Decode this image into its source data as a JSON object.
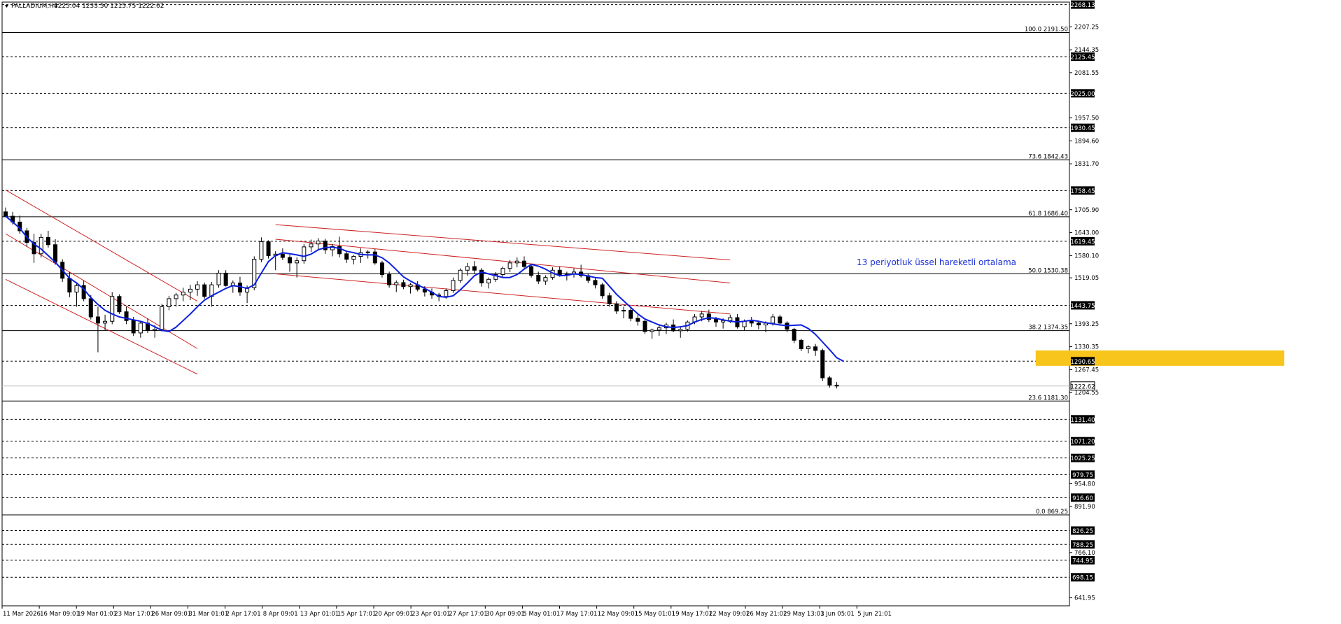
{
  "header": {
    "symbol": "PALLADIUM,H4",
    "ohlc": "1225.04 1233.50 1215.75 1222.62"
  },
  "annotation": {
    "ema_label": "13 periyotluk üssel hareketli ortalama"
  },
  "colors": {
    "background": "#ffffff",
    "candle": "#000000",
    "ema": "#0a1fe0",
    "channel": "#cc2222",
    "zone": "#f7c51b",
    "annotation": "#1a2fd6"
  },
  "chart_data": {
    "type": "candlestick",
    "ylim": [
      620,
      2275
    ],
    "y_tick_labels": [
      "2207.25",
      "2144.35",
      "2081.55",
      "1957.50",
      "1894.60",
      "1831.70",
      "1705.90",
      "1643.00",
      "1580.10",
      "1519.05",
      "1393.25",
      "1330.35",
      "1267.45",
      "1204.55",
      "891.90",
      "954.80",
      "766.10",
      "641.95"
    ],
    "y_ticks": [
      2207.25,
      2144.35,
      2081.55,
      1957.5,
      1894.6,
      1831.7,
      1705.9,
      1643.0,
      1580.1,
      1519.05,
      1393.25,
      1330.35,
      1267.45,
      1204.55,
      891.9,
      954.8,
      766.1,
      641.95
    ],
    "x_tick_labels": [
      "11 Mar 2026",
      "16 Mar 09:01",
      "19 Mar 01:01",
      "23 Mar 17:01",
      "26 Mar 09:01",
      "31 Mar 01:01",
      "2 Apr 17:01",
      "8 Apr 09:01",
      "13 Apr 01:01",
      "15 Apr 17:01",
      "20 Apr 09:01",
      "23 Apr 01:01",
      "27 Apr 17:01",
      "30 Apr 09:01",
      "5 May 01:01",
      "7 May 17:01",
      "12 May 09:01",
      "15 May 01:01",
      "19 May 17:01",
      "22 May 09:01",
      "26 May 21:01",
      "29 May 13:01",
      "3 Jun 05:01",
      "5 Jun 21:01"
    ],
    "horizontal_levels": [
      {
        "value": 2268.13,
        "label": "2268.13",
        "style": "dashed",
        "boxed": true
      },
      {
        "value": 2125.45,
        "label": "2125.45",
        "style": "dashed",
        "boxed": true
      },
      {
        "value": 2025.0,
        "label": "2025.00",
        "style": "dashed",
        "boxed": true
      },
      {
        "value": 1930.45,
        "label": "1930.45",
        "style": "dashed",
        "boxed": true
      },
      {
        "value": 1758.45,
        "label": "1758.45",
        "style": "dashed",
        "boxed": true
      },
      {
        "value": 1619.45,
        "label": "1619.45",
        "style": "dashed",
        "boxed": true
      },
      {
        "value": 1443.75,
        "label": "1443.75",
        "style": "dashed",
        "boxed": true
      },
      {
        "value": 1290.65,
        "label": "1290.65",
        "style": "dashed",
        "boxed": true
      },
      {
        "value": 1222.62,
        "label": "1222.62",
        "style": "current",
        "boxed": true
      },
      {
        "value": 1131.4,
        "label": "1131.40",
        "style": "dashed",
        "boxed": true
      },
      {
        "value": 1071.2,
        "label": "1071.20",
        "style": "dashed",
        "boxed": true
      },
      {
        "value": 1025.25,
        "label": "1025.25",
        "style": "dashed",
        "boxed": true
      },
      {
        "value": 979.75,
        "label": "979.75",
        "style": "dashed",
        "boxed": true
      },
      {
        "value": 916.6,
        "label": "916.60",
        "style": "dashed",
        "boxed": true
      },
      {
        "value": 826.25,
        "label": "826.25",
        "style": "dashed",
        "boxed": true
      },
      {
        "value": 788.25,
        "label": "788.25",
        "style": "dashed",
        "boxed": true
      },
      {
        "value": 744.95,
        "label": "744.95",
        "style": "dashed",
        "boxed": true
      },
      {
        "value": 698.15,
        "label": "698.15",
        "style": "dashed",
        "boxed": true
      }
    ],
    "fibonacci": [
      {
        "value": 2191.5,
        "label": "100.0 2191.50"
      },
      {
        "value": 1842.43,
        "label": "73.6 1842.43"
      },
      {
        "value": 1686.4,
        "label": "61.8 1686.40"
      },
      {
        "value": 1530.38,
        "label": "50.0 1530.38"
      },
      {
        "value": 1374.35,
        "label": "38.2 1374.35"
      },
      {
        "value": 1181.3,
        "label": "23.6 1181.30"
      },
      {
        "value": 869.25,
        "label": "0.0 869.25"
      }
    ],
    "ema_13": [
      1688,
      1672,
      1655,
      1630,
      1612,
      1598,
      1580,
      1562,
      1540,
      1518,
      1505,
      1488,
      1465,
      1446,
      1430,
      1420,
      1412,
      1408,
      1404,
      1400,
      1394,
      1385,
      1375,
      1372,
      1384,
      1402,
      1420,
      1440,
      1458,
      1470,
      1480,
      1490,
      1498,
      1495,
      1490,
      1500,
      1532,
      1564,
      1580,
      1588,
      1585,
      1582,
      1578,
      1584,
      1596,
      1602,
      1603,
      1600,
      1592,
      1588,
      1583,
      1582,
      1582,
      1574,
      1560,
      1541,
      1522,
      1510,
      1500,
      1490,
      1480,
      1468,
      1466,
      1470,
      1486,
      1505,
      1525,
      1535,
      1530,
      1525,
      1520,
      1520,
      1528,
      1543,
      1556,
      1551,
      1543,
      1532,
      1525,
      1526,
      1530,
      1528,
      1524,
      1520,
      1518,
      1496,
      1474,
      1456,
      1438,
      1420,
      1406,
      1398,
      1390,
      1385,
      1383,
      1385,
      1388,
      1398,
      1405,
      1410,
      1408,
      1404,
      1400,
      1398,
      1400,
      1403,
      1400,
      1396,
      1393,
      1390,
      1388,
      1389,
      1390,
      1380,
      1364,
      1343,
      1322,
      1300,
      1290
    ],
    "candles": [
      [
        1700,
        1712,
        1688,
        1688
      ],
      [
        1688,
        1700,
        1665,
        1672
      ],
      [
        1672,
        1690,
        1640,
        1648
      ],
      [
        1648,
        1656,
        1604,
        1616
      ],
      [
        1616,
        1640,
        1560,
        1585
      ],
      [
        1585,
        1640,
        1575,
        1630
      ],
      [
        1630,
        1648,
        1602,
        1610
      ],
      [
        1610,
        1625,
        1555,
        1562
      ],
      [
        1562,
        1570,
        1508,
        1518
      ],
      [
        1518,
        1535,
        1466,
        1480
      ],
      [
        1480,
        1505,
        1440,
        1498
      ],
      [
        1498,
        1512,
        1455,
        1462
      ],
      [
        1462,
        1472,
        1405,
        1412
      ],
      [
        1412,
        1440,
        1315,
        1395
      ],
      [
        1395,
        1418,
        1375,
        1400
      ],
      [
        1400,
        1480,
        1392,
        1468
      ],
      [
        1468,
        1474,
        1420,
        1426
      ],
      [
        1426,
        1440,
        1392,
        1402
      ],
      [
        1402,
        1412,
        1360,
        1368
      ],
      [
        1368,
        1400,
        1355,
        1395
      ],
      [
        1395,
        1408,
        1368,
        1375
      ],
      [
        1375,
        1390,
        1355,
        1378
      ],
      [
        1378,
        1448,
        1372,
        1440
      ],
      [
        1440,
        1470,
        1430,
        1462
      ],
      [
        1462,
        1478,
        1440,
        1472
      ],
      [
        1472,
        1492,
        1455,
        1480
      ],
      [
        1480,
        1500,
        1458,
        1488
      ],
      [
        1488,
        1510,
        1470,
        1500
      ],
      [
        1500,
        1506,
        1462,
        1468
      ],
      [
        1468,
        1508,
        1440,
        1500
      ],
      [
        1500,
        1540,
        1492,
        1532
      ],
      [
        1532,
        1540,
        1495,
        1498
      ],
      [
        1498,
        1512,
        1478,
        1505
      ],
      [
        1505,
        1522,
        1470,
        1480
      ],
      [
        1480,
        1498,
        1450,
        1492
      ],
      [
        1492,
        1578,
        1485,
        1570
      ],
      [
        1570,
        1630,
        1562,
        1618
      ],
      [
        1618,
        1622,
        1572,
        1580
      ],
      [
        1580,
        1592,
        1540,
        1584
      ],
      [
        1584,
        1600,
        1568,
        1575
      ],
      [
        1575,
        1582,
        1536,
        1560
      ],
      [
        1560,
        1575,
        1520,
        1566
      ],
      [
        1566,
        1612,
        1558,
        1604
      ],
      [
        1604,
        1624,
        1590,
        1612
      ],
      [
        1612,
        1628,
        1596,
        1620
      ],
      [
        1620,
        1626,
        1585,
        1596
      ],
      [
        1596,
        1612,
        1578,
        1605
      ],
      [
        1605,
        1632,
        1575,
        1585
      ],
      [
        1585,
        1594,
        1560,
        1570
      ],
      [
        1570,
        1582,
        1556,
        1578
      ],
      [
        1578,
        1600,
        1560,
        1588
      ],
      [
        1588,
        1595,
        1572,
        1590
      ],
      [
        1590,
        1598,
        1555,
        1560
      ],
      [
        1560,
        1566,
        1520,
        1528
      ],
      [
        1528,
        1536,
        1492,
        1500
      ],
      [
        1500,
        1512,
        1480,
        1506
      ],
      [
        1506,
        1514,
        1488,
        1495
      ],
      [
        1495,
        1505,
        1476,
        1500
      ],
      [
        1500,
        1510,
        1482,
        1488
      ],
      [
        1488,
        1496,
        1468,
        1480
      ],
      [
        1480,
        1490,
        1462,
        1472
      ],
      [
        1472,
        1478,
        1455,
        1468
      ],
      [
        1468,
        1490,
        1462,
        1484
      ],
      [
        1484,
        1520,
        1478,
        1512
      ],
      [
        1512,
        1545,
        1505,
        1540
      ],
      [
        1540,
        1560,
        1525,
        1550
      ],
      [
        1550,
        1565,
        1530,
        1540
      ],
      [
        1540,
        1546,
        1495,
        1505
      ],
      [
        1505,
        1520,
        1490,
        1515
      ],
      [
        1515,
        1535,
        1508,
        1528
      ],
      [
        1528,
        1550,
        1520,
        1545
      ],
      [
        1545,
        1568,
        1535,
        1560
      ],
      [
        1560,
        1575,
        1548,
        1565
      ],
      [
        1565,
        1578,
        1545,
        1550
      ],
      [
        1550,
        1556,
        1520,
        1526
      ],
      [
        1526,
        1536,
        1502,
        1510
      ],
      [
        1510,
        1526,
        1500,
        1520
      ],
      [
        1520,
        1548,
        1514,
        1540
      ],
      [
        1540,
        1550,
        1522,
        1528
      ],
      [
        1528,
        1536,
        1512,
        1530
      ],
      [
        1530,
        1545,
        1520,
        1535
      ],
      [
        1535,
        1555,
        1520,
        1525
      ],
      [
        1525,
        1530,
        1505,
        1512
      ],
      [
        1512,
        1520,
        1490,
        1500
      ],
      [
        1500,
        1505,
        1462,
        1470
      ],
      [
        1470,
        1478,
        1440,
        1448
      ],
      [
        1448,
        1455,
        1420,
        1428
      ],
      [
        1428,
        1440,
        1408,
        1430
      ],
      [
        1430,
        1438,
        1400,
        1408
      ],
      [
        1408,
        1420,
        1388,
        1400
      ],
      [
        1400,
        1406,
        1365,
        1372
      ],
      [
        1372,
        1380,
        1352,
        1376
      ],
      [
        1376,
        1392,
        1360,
        1382
      ],
      [
        1382,
        1396,
        1365,
        1390
      ],
      [
        1390,
        1405,
        1370,
        1374
      ],
      [
        1374,
        1384,
        1355,
        1378
      ],
      [
        1378,
        1402,
        1372,
        1398
      ],
      [
        1398,
        1420,
        1392,
        1412
      ],
      [
        1412,
        1428,
        1400,
        1420
      ],
      [
        1420,
        1432,
        1398,
        1405
      ],
      [
        1405,
        1412,
        1385,
        1398
      ],
      [
        1398,
        1408,
        1380,
        1402
      ],
      [
        1402,
        1418,
        1395,
        1410
      ],
      [
        1410,
        1420,
        1380,
        1385
      ],
      [
        1385,
        1405,
        1375,
        1400
      ],
      [
        1400,
        1412,
        1385,
        1395
      ],
      [
        1395,
        1402,
        1378,
        1390
      ],
      [
        1390,
        1400,
        1370,
        1395
      ],
      [
        1395,
        1420,
        1388,
        1412
      ],
      [
        1412,
        1418,
        1390,
        1395
      ],
      [
        1395,
        1400,
        1370,
        1378
      ],
      [
        1378,
        1382,
        1340,
        1348
      ],
      [
        1348,
        1352,
        1318,
        1325
      ],
      [
        1325,
        1334,
        1312,
        1330
      ],
      [
        1330,
        1338,
        1305,
        1320
      ],
      [
        1320,
        1325,
        1236,
        1245
      ],
      [
        1245,
        1250,
        1218,
        1225
      ],
      [
        1225,
        1233.5,
        1215.75,
        1222.62
      ]
    ],
    "channel_lines": [
      {
        "name": "",
        "x1": 0,
        "y1": 1760,
        "x2": 27,
        "y2": 1455
      },
      {
        "name": "",
        "x1": 0,
        "y1": 1640,
        "x2": 27,
        "y2": 1325
      },
      {
        "name": "",
        "x1": 0,
        "y1": 1515,
        "x2": 27,
        "y2": 1255
      },
      {
        "name": "",
        "x1": 38,
        "y1": 1665,
        "x2": 102,
        "y2": 1568
      },
      {
        "name": "",
        "x1": 38,
        "y1": 1625,
        "x2": 102,
        "y2": 1505
      },
      {
        "name": "",
        "x1": 38,
        "y1": 1530,
        "x2": 102,
        "y2": 1420
      }
    ],
    "zone": {
      "x_start": 145,
      "x_end": 180,
      "y_low": 1278,
      "y_high": 1320
    }
  }
}
